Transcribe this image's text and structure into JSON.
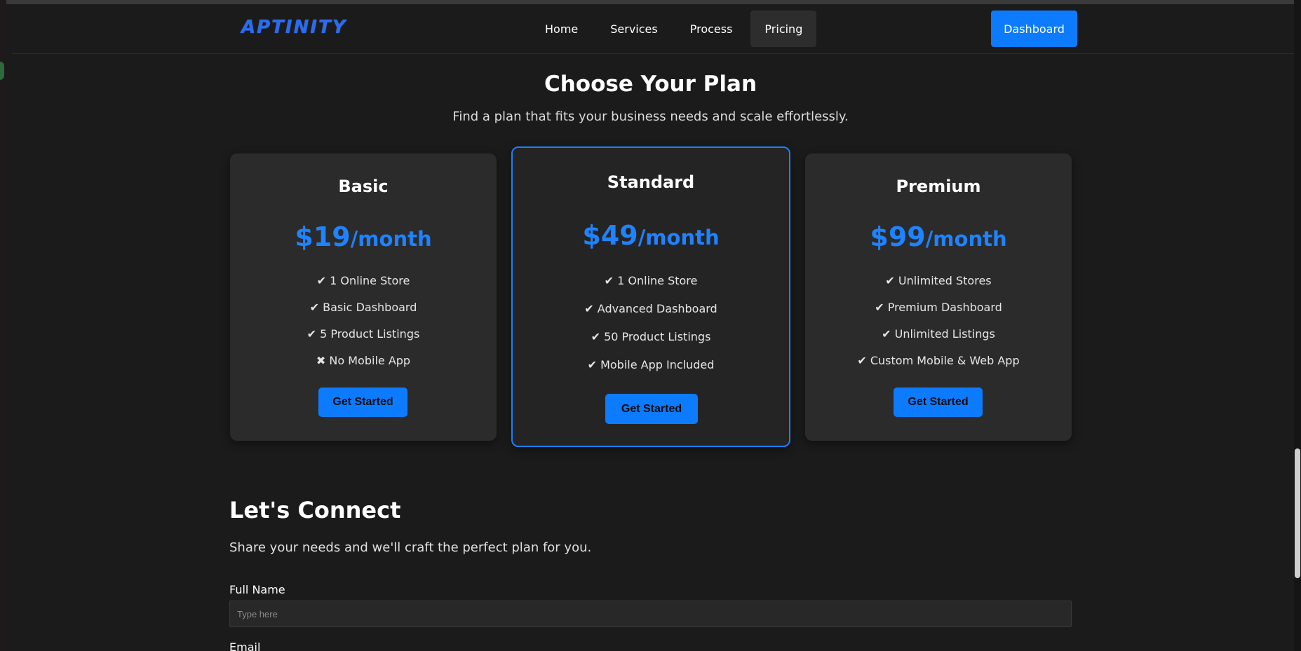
{
  "brand": {
    "logo_text": "APTINITY"
  },
  "nav": {
    "links": [
      {
        "label": "Home",
        "active": false
      },
      {
        "label": "Services",
        "active": false
      },
      {
        "label": "Process",
        "active": false
      },
      {
        "label": "Pricing",
        "active": true
      }
    ],
    "dashboard_label": "Dashboard"
  },
  "pricing": {
    "title": "Choose Your Plan",
    "subtitle": "Find a plan that fits your business needs and scale effortlessly.",
    "plans": [
      {
        "name": "Basic",
        "price": "$19",
        "period": "/month",
        "features": [
          "✔ 1 Online Store",
          "✔ Basic Dashboard",
          "✔ 5 Product Listings",
          "✖ No Mobile App"
        ],
        "cta": "Get Started",
        "featured": false
      },
      {
        "name": "Standard",
        "price": "$49",
        "period": "/month",
        "features": [
          "✔ 1 Online Store",
          "✔ Advanced Dashboard",
          "✔ 50 Product Listings",
          "✔ Mobile App Included"
        ],
        "cta": "Get Started",
        "featured": true
      },
      {
        "name": "Premium",
        "price": "$99",
        "period": "/month",
        "features": [
          "✔ Unlimited Stores",
          "✔ Premium Dashboard",
          "✔ Unlimited Listings",
          "✔ Custom Mobile & Web App"
        ],
        "cta": "Get Started",
        "featured": false
      }
    ]
  },
  "connect": {
    "title": "Let's Connect",
    "subtitle": "Share your needs and we'll craft the perfect plan for you.",
    "full_name_label": "Full Name",
    "full_name_placeholder": "Type here",
    "full_name_value": "",
    "email_label": "Email"
  },
  "colors": {
    "background": "#1b1b1b",
    "accent": "#0d7bfd",
    "card": "#2b2b2b",
    "featured_border": "#1e7efb"
  }
}
